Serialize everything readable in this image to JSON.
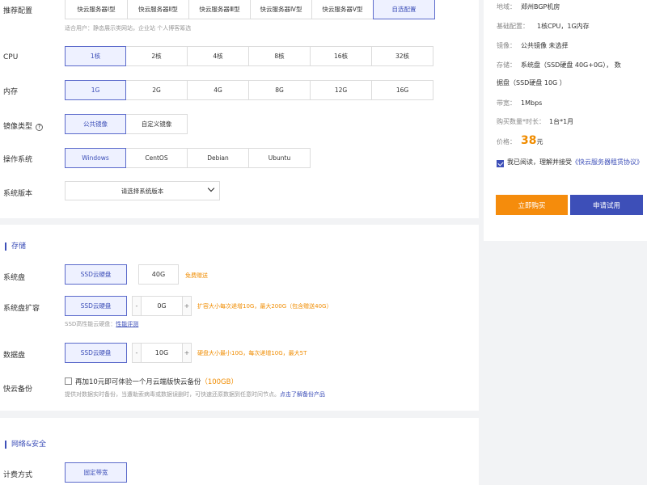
{
  "config": {
    "recommend": {
      "label": "推荐配置",
      "options": [
        "快云服务器Ⅰ型",
        "快云服务器Ⅱ型",
        "快云服务器Ⅲ型",
        "快云服务器Ⅳ型",
        "快云服务器Ⅴ型",
        "自选配置"
      ],
      "selected": 5,
      "hint": "适合用户：静态展示类网站，企业站 个人博客筹选"
    },
    "cpu": {
      "label": "CPU",
      "options": [
        "1核",
        "2核",
        "4核",
        "8核",
        "16核",
        "32核"
      ],
      "selected": 0
    },
    "memory": {
      "label": "内存",
      "options": [
        "1G",
        "2G",
        "4G",
        "8G",
        "12G",
        "16G"
      ],
      "selected": 0
    },
    "image_type": {
      "label": "镜像类型",
      "help_icon": "?",
      "options": [
        "公共镜像",
        "自定义镜像"
      ],
      "selected": 0
    },
    "os": {
      "label": "操作系统",
      "options": [
        "Windows",
        "CentOS",
        "Debian",
        "Ubuntu"
      ],
      "selected": 0
    },
    "version": {
      "label": "系统版本",
      "placeholder": "请选择系统版本"
    }
  },
  "storage": {
    "title": "存储",
    "system_disk": {
      "label": "系统盘",
      "type": "SSD云硬盘",
      "size": "40G",
      "note": "免费赠送"
    },
    "system_expand": {
      "label": "系统盘扩容",
      "type": "SSD云硬盘",
      "minus": "-",
      "plus": "+",
      "value": "0G",
      "note": "扩容大小每次递增10G，最大200G（包含赠送40G）",
      "hint_prefix": "SSD高性能云硬盘：",
      "hint_link": "性能评测"
    },
    "data_disk": {
      "label": "数据盘",
      "type": "SSD云硬盘",
      "minus": "-",
      "plus": "+",
      "value": "10G",
      "note": "硬盘大小最小10G，每次递增10G，最大5T"
    },
    "backup": {
      "label": "快云备份",
      "text": "再加10元即可体验一个月云端版快云备份",
      "size": "（100GB）",
      "hint": "提供对数据实时备份，当遭勒索病毒或数据误删时，可快速还原数据到任意时间节点。",
      "hint_link": "点击了解备份产品"
    }
  },
  "network": {
    "title": "网络&安全",
    "billing": {
      "label": "计费方式",
      "option": "固定带宽"
    }
  },
  "summary": {
    "region": {
      "key": "地域：",
      "value": "郑州BGP机房"
    },
    "basic": {
      "key": "基础配置：",
      "value": "1核CPU，1G内存"
    },
    "image": {
      "key": "镜像：",
      "value": "公共镜像 未选择"
    },
    "storage": {
      "key": "存储：",
      "value": "系统盘（SSD硬盘 40G+0G）， 数",
      "value2": "据盘（SSD硬盘 10G ）"
    },
    "bandwidth": {
      "key": "带宽：",
      "value": "1Mbps"
    },
    "quantity": {
      "key": "购买数量*时长：",
      "value": "1台*1月"
    },
    "price": {
      "key": "价格：",
      "amount": "38",
      "unit": "元"
    },
    "agreement": {
      "prefix": "我已阅读，理解并接受",
      "link": "《快云服务器租赁协议》",
      "checked": true
    },
    "buy_button": "立即购买",
    "trial_button": "申请试用"
  },
  "colors": {
    "accent": "#3d4fb8",
    "orange": "#f58c0c",
    "selected_bg": "#eef1ff"
  }
}
